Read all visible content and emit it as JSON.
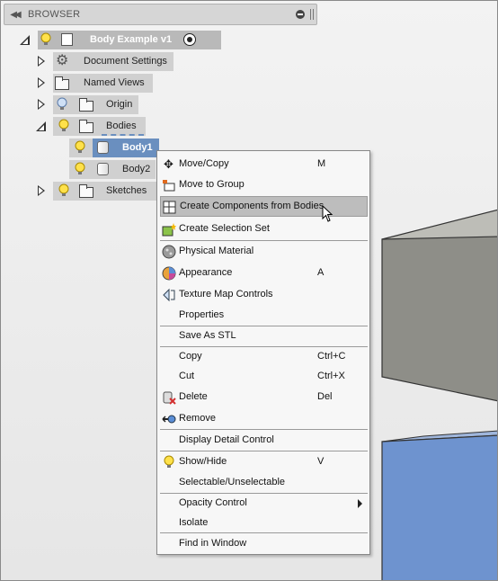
{
  "browser": {
    "title": "BROWSER"
  },
  "tree": {
    "root": {
      "label": "Body Example v1",
      "icon": "component-icon"
    },
    "document_settings": {
      "label": "Document Settings"
    },
    "named_views": {
      "label": "Named Views"
    },
    "origin": {
      "label": "Origin"
    },
    "bodies": {
      "label": "Bodies"
    },
    "body1": {
      "label": "Body1"
    },
    "body2": {
      "label": "Body2"
    },
    "sketches": {
      "label": "Sketches"
    }
  },
  "context_menu": {
    "items": [
      {
        "label": "Move/Copy",
        "shortcut": "M",
        "icon": "move-icon"
      },
      {
        "label": "Move to Group",
        "shortcut": "",
        "icon": "folder-move-icon"
      },
      {
        "label": "Create Components from Bodies",
        "shortcut": "",
        "icon": "create-components-icon",
        "highlighted": true
      },
      {
        "label": "Create Selection Set",
        "shortcut": "",
        "icon": "selection-set-icon"
      },
      {
        "label": "Physical Material",
        "shortcut": "",
        "icon": "material-icon"
      },
      {
        "label": "Appearance",
        "shortcut": "A",
        "icon": "appearance-icon"
      },
      {
        "label": "Texture Map Controls",
        "shortcut": "",
        "icon": "texture-map-icon"
      },
      {
        "label": "Properties",
        "shortcut": ""
      },
      {
        "label": "Save As STL",
        "shortcut": ""
      },
      {
        "label": "Copy",
        "shortcut": "Ctrl+C"
      },
      {
        "label": "Cut",
        "shortcut": "Ctrl+X"
      },
      {
        "label": "Delete",
        "shortcut": "Del",
        "icon": "delete-icon"
      },
      {
        "label": "Remove",
        "shortcut": "",
        "icon": "remove-icon"
      },
      {
        "label": "Display Detail Control",
        "shortcut": ""
      },
      {
        "label": "Show/Hide",
        "shortcut": "V",
        "icon": "lightbulb-icon"
      },
      {
        "label": "Selectable/Unselectable",
        "shortcut": ""
      },
      {
        "label": "Opacity Control",
        "shortcut": "",
        "submenu": true
      },
      {
        "label": "Isolate",
        "shortcut": ""
      },
      {
        "label": "Find in Window",
        "shortcut": ""
      }
    ]
  },
  "colors": {
    "selection_blue": "#6a8fbf",
    "gray_box_front": "#8c8c86",
    "gray_box_top": "#a8a8a2",
    "blue_box": "#6e93cf",
    "menu_highlight": "#bdbdbd"
  }
}
